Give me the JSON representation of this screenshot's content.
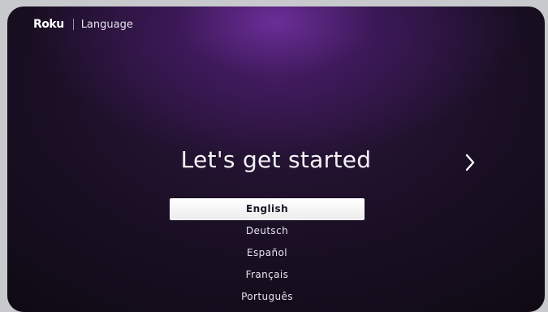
{
  "header": {
    "brand": "Roku",
    "title": "Language"
  },
  "main": {
    "headline": "Let's get started",
    "next_icon": "chevron-right-icon"
  },
  "languages": {
    "selected_index": 0,
    "items": [
      {
        "label": "English"
      },
      {
        "label": "Deutsch"
      },
      {
        "label": "Español"
      },
      {
        "label": "Français"
      },
      {
        "label": "Português"
      }
    ]
  },
  "colors": {
    "background": "#1a0f24",
    "accent_glow": "#6f2c9e",
    "selected_bg": "#ffffff",
    "selected_text": "#1c1424",
    "text": "#ffffff"
  }
}
